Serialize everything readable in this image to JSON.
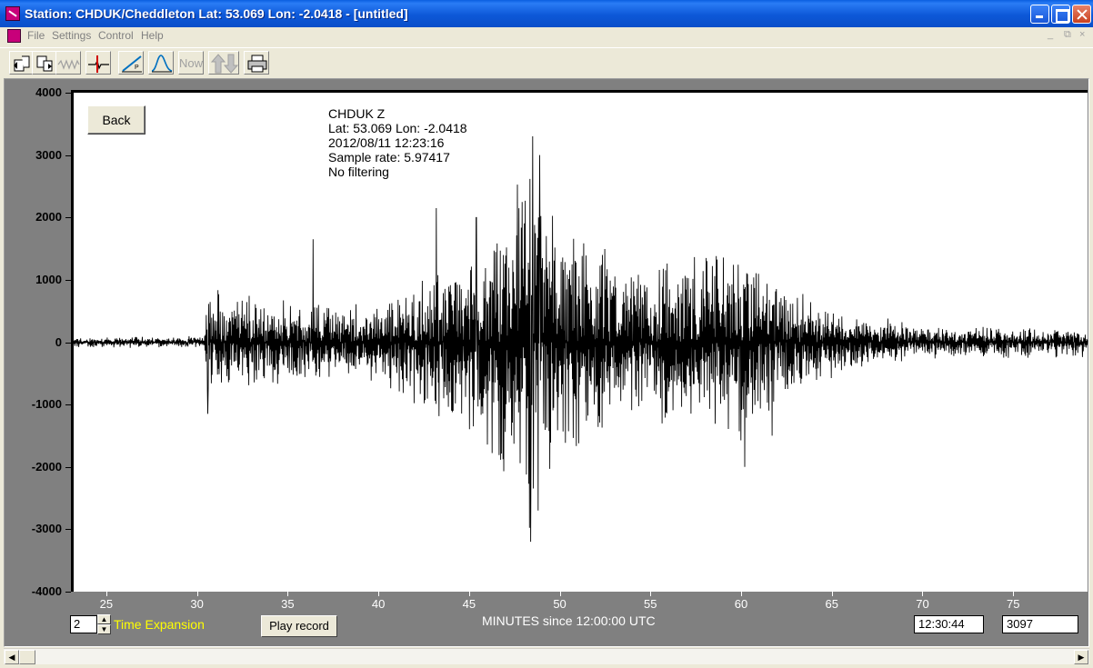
{
  "window": {
    "title": "Station: CHDUK/Cheddleton Lat: 53.069 Lon: -2.0418 - [untitled]"
  },
  "menu": {
    "items": [
      "File",
      "Settings",
      "Control",
      "Help"
    ],
    "mdi_controls": [
      "_",
      "⧉",
      "×"
    ]
  },
  "toolbar": {
    "now_label": "Now"
  },
  "plot": {
    "back_label": "Back",
    "info": {
      "station": "CHDUK  Z",
      "location": "Lat: 53.069 Lon: -2.0418",
      "datetime": "2012/08/11 12:23:16",
      "sample_rate": "Sample rate: 5.97417",
      "filtering": "No filtering"
    },
    "y_ticks": [
      "4000",
      "3000",
      "2000",
      "1000",
      "0",
      "-1000",
      "-2000",
      "-3000",
      "-4000"
    ],
    "x_ticks": [
      "25",
      "30",
      "35",
      "40",
      "45",
      "50",
      "55",
      "60",
      "65",
      "70",
      "75"
    ],
    "x_axis_title": "MINUTES since 12:00:00 UTC"
  },
  "controls": {
    "time_expansion_value": "2",
    "time_expansion_label": "Time Expansion",
    "play_label": "Play record",
    "time_readout": "12:30:44",
    "value_readout": "3097"
  },
  "chart_data": {
    "type": "line",
    "xlabel": "MINUTES since 12:00:00 UTC",
    "ylabel": "",
    "xlim": [
      23.2,
      79.1
    ],
    "ylim": [
      -4000,
      4000
    ],
    "series": [
      {
        "name": "CHDUK  Z",
        "envelope": [
          {
            "x": 23.2,
            "amp": 100
          },
          {
            "x": 30.4,
            "amp": 100
          },
          {
            "x": 30.5,
            "amp": 1000
          },
          {
            "x": 33,
            "amp": 800
          },
          {
            "x": 36,
            "amp": 700
          },
          {
            "x": 40,
            "amp": 700
          },
          {
            "x": 43,
            "amp": 1300
          },
          {
            "x": 45.5,
            "amp": 1700
          },
          {
            "x": 48.5,
            "amp": 3300
          },
          {
            "x": 50,
            "amp": 2000
          },
          {
            "x": 55,
            "amp": 1400
          },
          {
            "x": 60,
            "amp": 1800
          },
          {
            "x": 63,
            "amp": 900
          },
          {
            "x": 66,
            "amp": 500
          },
          {
            "x": 70,
            "amp": 300
          },
          {
            "x": 79.1,
            "amp": 250
          }
        ],
        "peaks": [
          {
            "x": 30.6,
            "y": 950
          },
          {
            "x": 30.6,
            "y": -1150
          },
          {
            "x": 36.4,
            "y": 1650
          },
          {
            "x": 43.2,
            "y": 2150
          },
          {
            "x": 45.4,
            "y": 2000
          },
          {
            "x": 48.5,
            "y": 3300
          },
          {
            "x": 48.4,
            "y": -3200
          },
          {
            "x": 48.8,
            "y": -2700
          },
          {
            "x": 48.9,
            "y": 3000
          },
          {
            "x": 60.2,
            "y": 1950
          },
          {
            "x": 60.2,
            "y": -2000
          },
          {
            "x": 61.7,
            "y": -1500
          }
        ]
      }
    ]
  }
}
